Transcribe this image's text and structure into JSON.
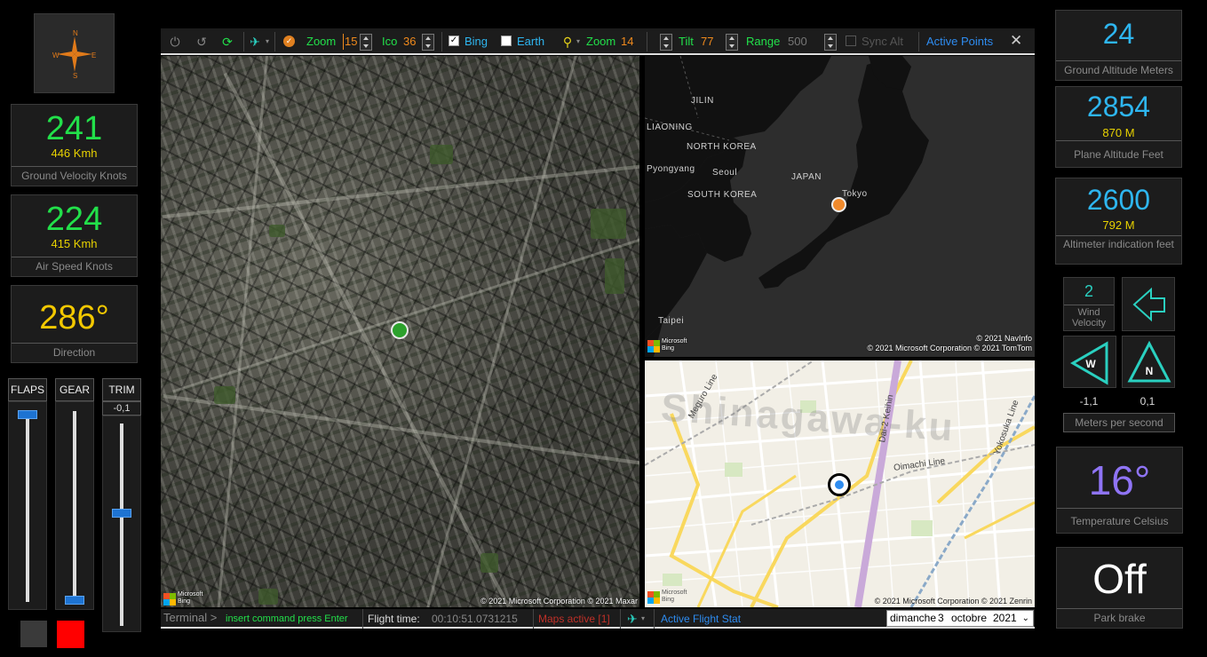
{
  "compass": {
    "letters": [
      "N",
      "E",
      "S",
      "W"
    ]
  },
  "ground_velocity": {
    "value": "241",
    "sub": "446 Kmh",
    "label": "Ground Velocity Knots"
  },
  "air_speed": {
    "value": "224",
    "sub": "415 Kmh",
    "label": "Air Speed Knots"
  },
  "direction": {
    "value": "286°",
    "label": "Direction"
  },
  "sliders": {
    "flaps": {
      "label": "FLAPS",
      "level": 0.0
    },
    "gear": {
      "label": "GEAR",
      "level": 1.0
    },
    "trim": {
      "label": "TRIM",
      "value": "-0,1",
      "level": 0.45
    }
  },
  "colors": {
    "accent_green": "#22e04a",
    "accent_blue": "#2eb6f0",
    "accent_yellow": "#f3c800",
    "accent_violet": "#8f74f6",
    "red_square": "#ff0000",
    "gray_square": "#3a3a3a"
  },
  "toolbar": {
    "icons": [
      "power-icon",
      "reset-icon",
      "refresh-icon",
      "plane-icon",
      "check-icon"
    ],
    "zoom_label": "Zoom",
    "zoom_value": "15",
    "ico_label": "Ico",
    "ico_value": "36",
    "bing_label": "Bing",
    "bing_checked": true,
    "earth_label": "Earth",
    "earth_checked": false,
    "zoom2_label": "Zoom",
    "zoom2_value": "14",
    "tilt_label": "Tilt",
    "tilt_value": "77",
    "range_label": "Range",
    "range_value": "500",
    "sync_label": "Sync Alt",
    "sync_checked": false,
    "active_points": "Active Points",
    "close": "✕"
  },
  "maps": {
    "satellite": {
      "copyright": "© 2021 Microsoft Corporation © 2021 Maxar",
      "logo": "Microsoft Bing"
    },
    "region": {
      "labels": [
        "JILIN",
        "LIAONING",
        "NORTH KOREA",
        "Pyongyang",
        "Seoul",
        "SOUTH KOREA",
        "JAPAN",
        "Tokyo",
        "Taipei"
      ],
      "copyright": "© 2021 NavInfo\n© 2021 Microsoft Corporation © 2021 TomTom",
      "copyright_1": "© 2021 NavInfo",
      "copyright_2": "© 2021 Microsoft Corporation © 2021 TomTom",
      "logo": "Microsoft Bing"
    },
    "street": {
      "area": "Shinagawa-ku",
      "lines": [
        "Meguro Line",
        "Dai-2 Keihin",
        "Oimachi Line",
        "Yokosuka Line"
      ],
      "copyright": "© 2021 Microsoft Corporation © 2021 Zenrin",
      "logo": "Microsoft Bing"
    }
  },
  "status": {
    "terminal": "Terminal >",
    "command_placeholder": "insert command press Enter",
    "flight_time_label": "Flight time:",
    "flight_time": "00:10:51.0731215",
    "maps_active": "Maps active [1]",
    "active_flight": "Active Flight Stat",
    "date": {
      "day": "dimanche",
      "num": "3",
      "month": "octobre",
      "year": "2021"
    }
  },
  "ground_altitude": {
    "value": "24",
    "label": "Ground Altitude Meters"
  },
  "plane_altitude": {
    "value": "2854",
    "sub": "870 M",
    "label": "Plane Altitude Feet"
  },
  "altimeter": {
    "value": "2600",
    "sub": "792 M",
    "label": "Altimeter indication feet"
  },
  "wind": {
    "velocity": "2",
    "velocity_label": "Wind Velocity",
    "w_letter": "W",
    "n_letter": "N",
    "w_value": "-1,1",
    "n_value": "0,1",
    "mps_label": "Meters per second"
  },
  "temperature": {
    "value": "16°",
    "label": "Temperature Celsius"
  },
  "park_brake": {
    "value": "Off",
    "label": "Park brake"
  }
}
